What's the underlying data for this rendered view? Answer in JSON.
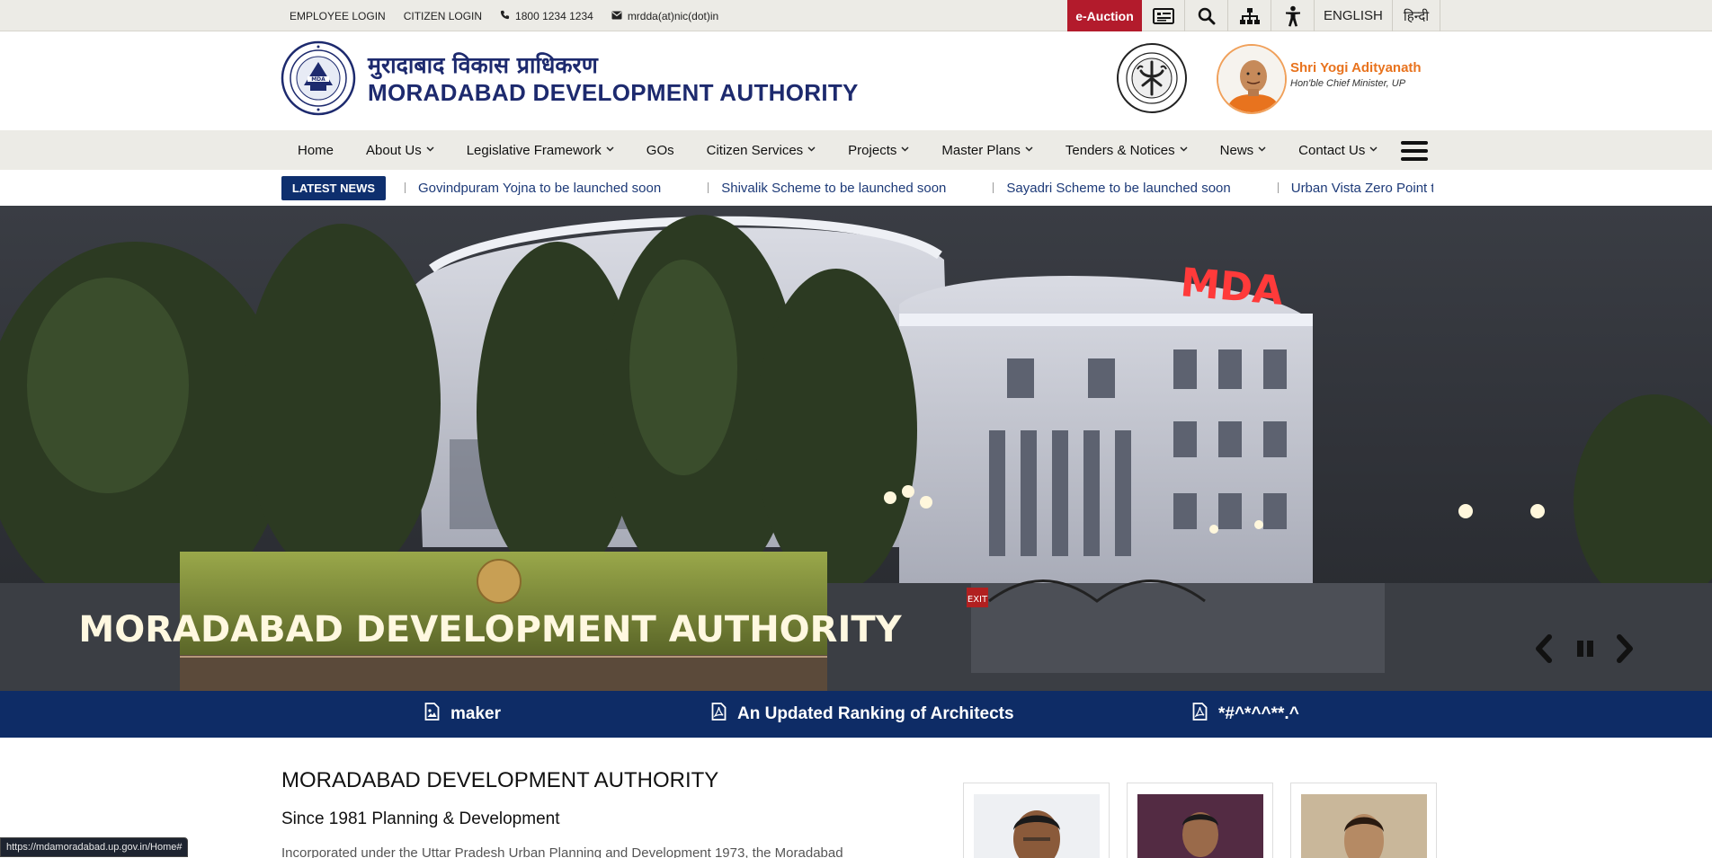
{
  "topbar": {
    "employee_login": "EMPLOYEE LOGIN",
    "citizen_login": "CITIZEN LOGIN",
    "phone": "1800 1234 1234",
    "email": "mrdda(at)nic(dot)in",
    "eauction": "e-Auction",
    "lang_en": "ENGLISH",
    "lang_hi": "हिन्दी"
  },
  "header": {
    "title_hi": "मुरादाबाद विकास प्राधिकरण",
    "title_en": "MORADABAD DEVELOPMENT AUTHORITY",
    "cm_name": "Shri Yogi Adityanath",
    "cm_role": "Hon'ble Chief Minister, UP"
  },
  "nav": {
    "items": [
      {
        "label": "Home",
        "dropdown": false
      },
      {
        "label": "About Us",
        "dropdown": true
      },
      {
        "label": "Legislative Framework",
        "dropdown": true
      },
      {
        "label": "GOs",
        "dropdown": false
      },
      {
        "label": "Citizen Services",
        "dropdown": true
      },
      {
        "label": "Projects",
        "dropdown": true
      },
      {
        "label": "Master Plans",
        "dropdown": true
      },
      {
        "label": "Tenders & Notices",
        "dropdown": true
      },
      {
        "label": "News",
        "dropdown": true
      },
      {
        "label": "Contact Us",
        "dropdown": true
      }
    ]
  },
  "ticker": {
    "label": "LATEST NEWS",
    "items": [
      "Govindpuram Yojna to be launched soon",
      "Shivalik Scheme to be launched soon",
      "Sayadri Scheme to be launched soon",
      "Urban Vista Zero Point to be launched soon"
    ]
  },
  "hero": {
    "sign_text": "MORADABAD DEVELOPMENT AUTHORITY",
    "neon_text": "MDA",
    "exit_text": "EXIT"
  },
  "strip": {
    "items": [
      "maker",
      "An Updated Ranking of Architects",
      "*#^*^^**.^"
    ]
  },
  "content": {
    "title": "MORADABAD DEVELOPMENT AUTHORITY",
    "subtitle": "Since 1981 Planning & Development",
    "para": "Incorporated under the Uttar Pradesh Urban Planning and Development 1973, the Moradabad"
  },
  "status_url": "https://mdamoradabad.up.gov.in/Home#",
  "colors": {
    "navy": "#0e2c66",
    "eauction_red": "#b31b2c",
    "title_blue": "#1d2a6e",
    "cm_orange": "#e8731e"
  }
}
